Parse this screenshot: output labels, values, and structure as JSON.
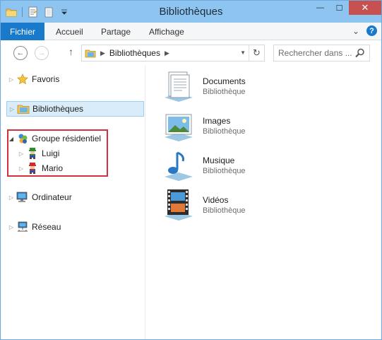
{
  "window": {
    "title": "Bibliothèques"
  },
  "titlebar": {
    "minimize_symbol": "—",
    "maximize_symbol": "☐",
    "close_symbol": "✕"
  },
  "ribbon": {
    "file_tab": "Fichier",
    "tabs": [
      "Accueil",
      "Partage",
      "Affichage"
    ],
    "expand_symbol": "⌄",
    "help_symbol": "?"
  },
  "address": {
    "path": "Bibliothèques",
    "back_symbol": "←",
    "forward_symbol": "→",
    "up_symbol": "↑",
    "refresh_symbol": "↻"
  },
  "search": {
    "placeholder": "Rechercher dans ..."
  },
  "nav": {
    "items": [
      {
        "label": "Favoris",
        "icon": "star-icon"
      },
      {
        "label": "Bibliothèques",
        "icon": "libraries-icon"
      },
      {
        "label": "Groupe résidentiel",
        "icon": "homegroup-icon"
      },
      {
        "label": "Luigi",
        "icon": "luigi-avatar-icon"
      },
      {
        "label": "Mario",
        "icon": "mario-avatar-icon"
      },
      {
        "label": "Ordinateur",
        "icon": "computer-icon"
      },
      {
        "label": "Réseau",
        "icon": "network-icon"
      }
    ]
  },
  "libraries": [
    {
      "name": "Documents",
      "type": "Bibliothèque",
      "icon": "documents-library-icon"
    },
    {
      "name": "Images",
      "type": "Bibliothèque",
      "icon": "pictures-library-icon"
    },
    {
      "name": "Musique",
      "type": "Bibliothèque",
      "icon": "music-library-icon"
    },
    {
      "name": "Vidéos",
      "type": "Bibliothèque",
      "icon": "videos-library-icon"
    }
  ],
  "colors": {
    "titlebar": "#8dc5f0",
    "file_tab": "#1979ca",
    "close_button": "#c75050",
    "selection": "#d9ecf9",
    "highlight_box": "#d3303d"
  }
}
